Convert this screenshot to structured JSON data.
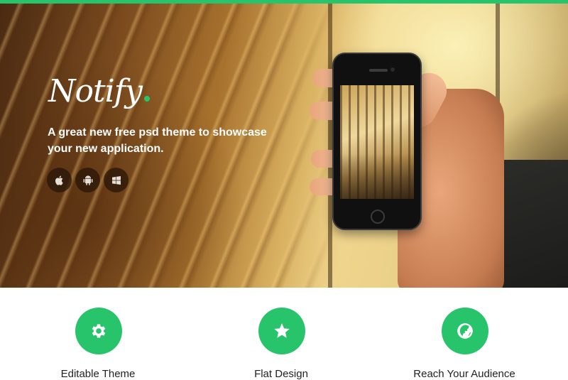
{
  "hero": {
    "logo_text": "Notify",
    "tagline": "A great new free psd theme to showcase your new application.",
    "platforms": [
      {
        "icon": "apple-icon"
      },
      {
        "icon": "android-icon"
      },
      {
        "icon": "windows-icon"
      }
    ]
  },
  "features": [
    {
      "icon": "gear-icon",
      "title": "Editable Theme"
    },
    {
      "icon": "star-icon",
      "title": "Flat Design"
    },
    {
      "icon": "globe-icon",
      "title": "Reach Your Audience"
    }
  ],
  "colors": {
    "accent": "#27c46b",
    "text_dark": "#222222",
    "hero_text": "#ffffff"
  }
}
